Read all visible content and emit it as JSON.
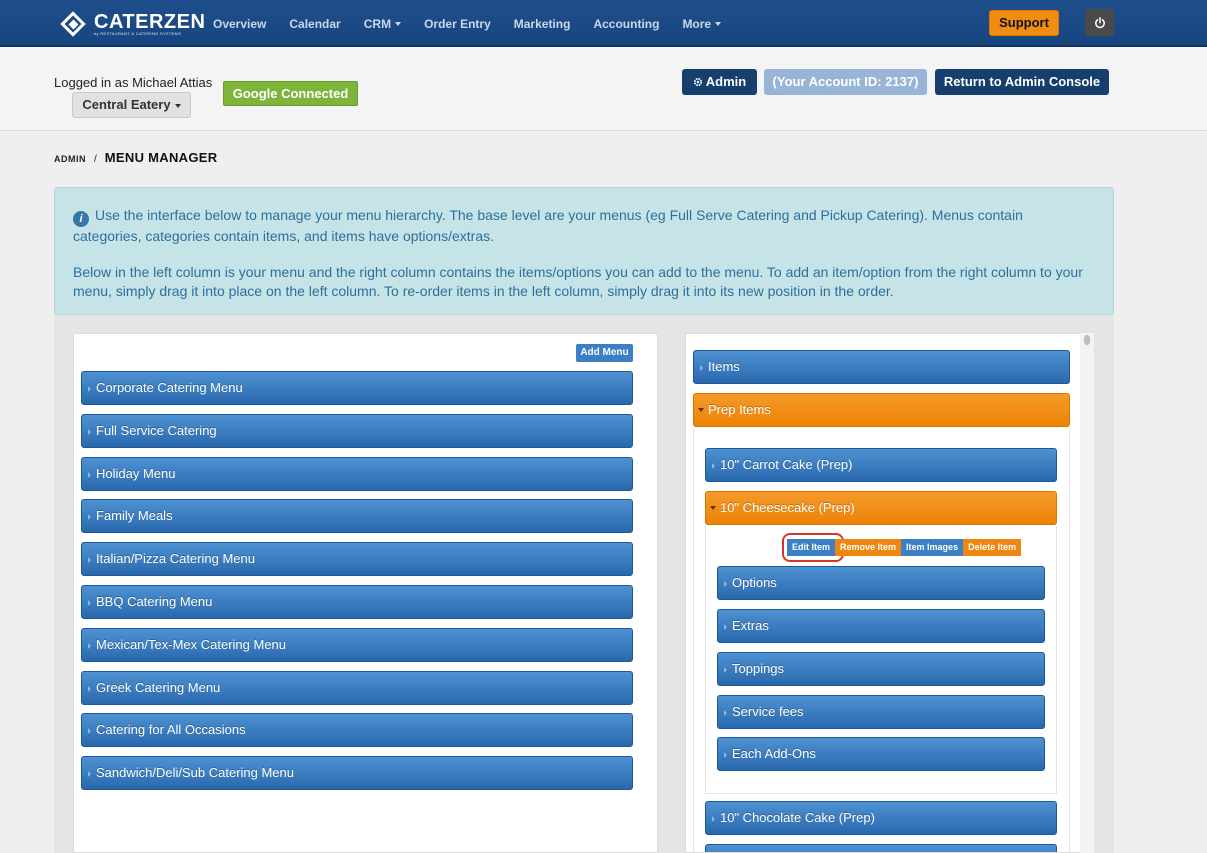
{
  "brand": {
    "name": "CATERZEN",
    "tagline": "by RESTAURANT & CATERING SYSTEMS"
  },
  "nav": {
    "items": [
      {
        "label": "Overview",
        "dropdown": false
      },
      {
        "label": "Calendar",
        "dropdown": false
      },
      {
        "label": "CRM",
        "dropdown": true
      },
      {
        "label": "Order Entry",
        "dropdown": false
      },
      {
        "label": "Marketing",
        "dropdown": false
      },
      {
        "label": "Accounting",
        "dropdown": false
      },
      {
        "label": "More",
        "dropdown": true
      }
    ],
    "support_label": "Support",
    "power_icon": "power-icon"
  },
  "account": {
    "logged_in_text": "Logged in as Michael Attias",
    "store_label": "Central Eatery",
    "google_label": "Google Connected",
    "admin_label": "Admin",
    "account_id_label": "(Your Account ID: 2137)",
    "return_label": "Return to Admin Console"
  },
  "breadcrumb": {
    "root": "ADMIN",
    "separator": "/",
    "current": "MENU MANAGER"
  },
  "info": {
    "paragraph1": "Use the interface below to manage your menu hierarchy. The base level are your menus (eg Full Serve Catering and Pickup Catering). Menus contain categories, categories contain items, and items have options/extras.",
    "paragraph2": "Below in the left column is your menu and the right column contains the items/options you can add to the menu. To add an item/option from the right column to your menu, simply drag it into place on the left column. To re-order items in the left column, simply drag it into its new position in the order."
  },
  "left_column": {
    "add_menu_label": "Add Menu",
    "menus": [
      "Corporate Catering Menu",
      "Full Service Catering",
      "Holiday Menu",
      "Family Meals",
      "Italian/Pizza Catering Menu",
      "BBQ Catering Menu",
      "Mexican/Tex-Mex Catering Menu",
      "Greek Catering Menu",
      "Catering for All Occasions",
      "Sandwich/Deli/Sub Catering Menu"
    ]
  },
  "right_column": {
    "items_label": "Items",
    "prep_items_label": "Prep Items",
    "carrot_cake": "10\" Carrot Cake (Prep)",
    "cheesecake": "10\" Cheesecake (Prep)",
    "actions": {
      "edit": "Edit Item",
      "remove": "Remove Item",
      "images": "Item Images",
      "delete": "Delete Item"
    },
    "sub_groups": [
      "Options",
      "Extras",
      "Toppings",
      "Service fees",
      "Each Add-Ons"
    ],
    "chocolate_cake": "10\" Chocolate Cake (Prep)"
  },
  "colors": {
    "nav_bg": "#1f4f8c",
    "accent_orange": "#ee8610",
    "bar_blue": "#2a68ad",
    "info_bg": "#c6e4e8",
    "google_green": "#7db43a"
  }
}
